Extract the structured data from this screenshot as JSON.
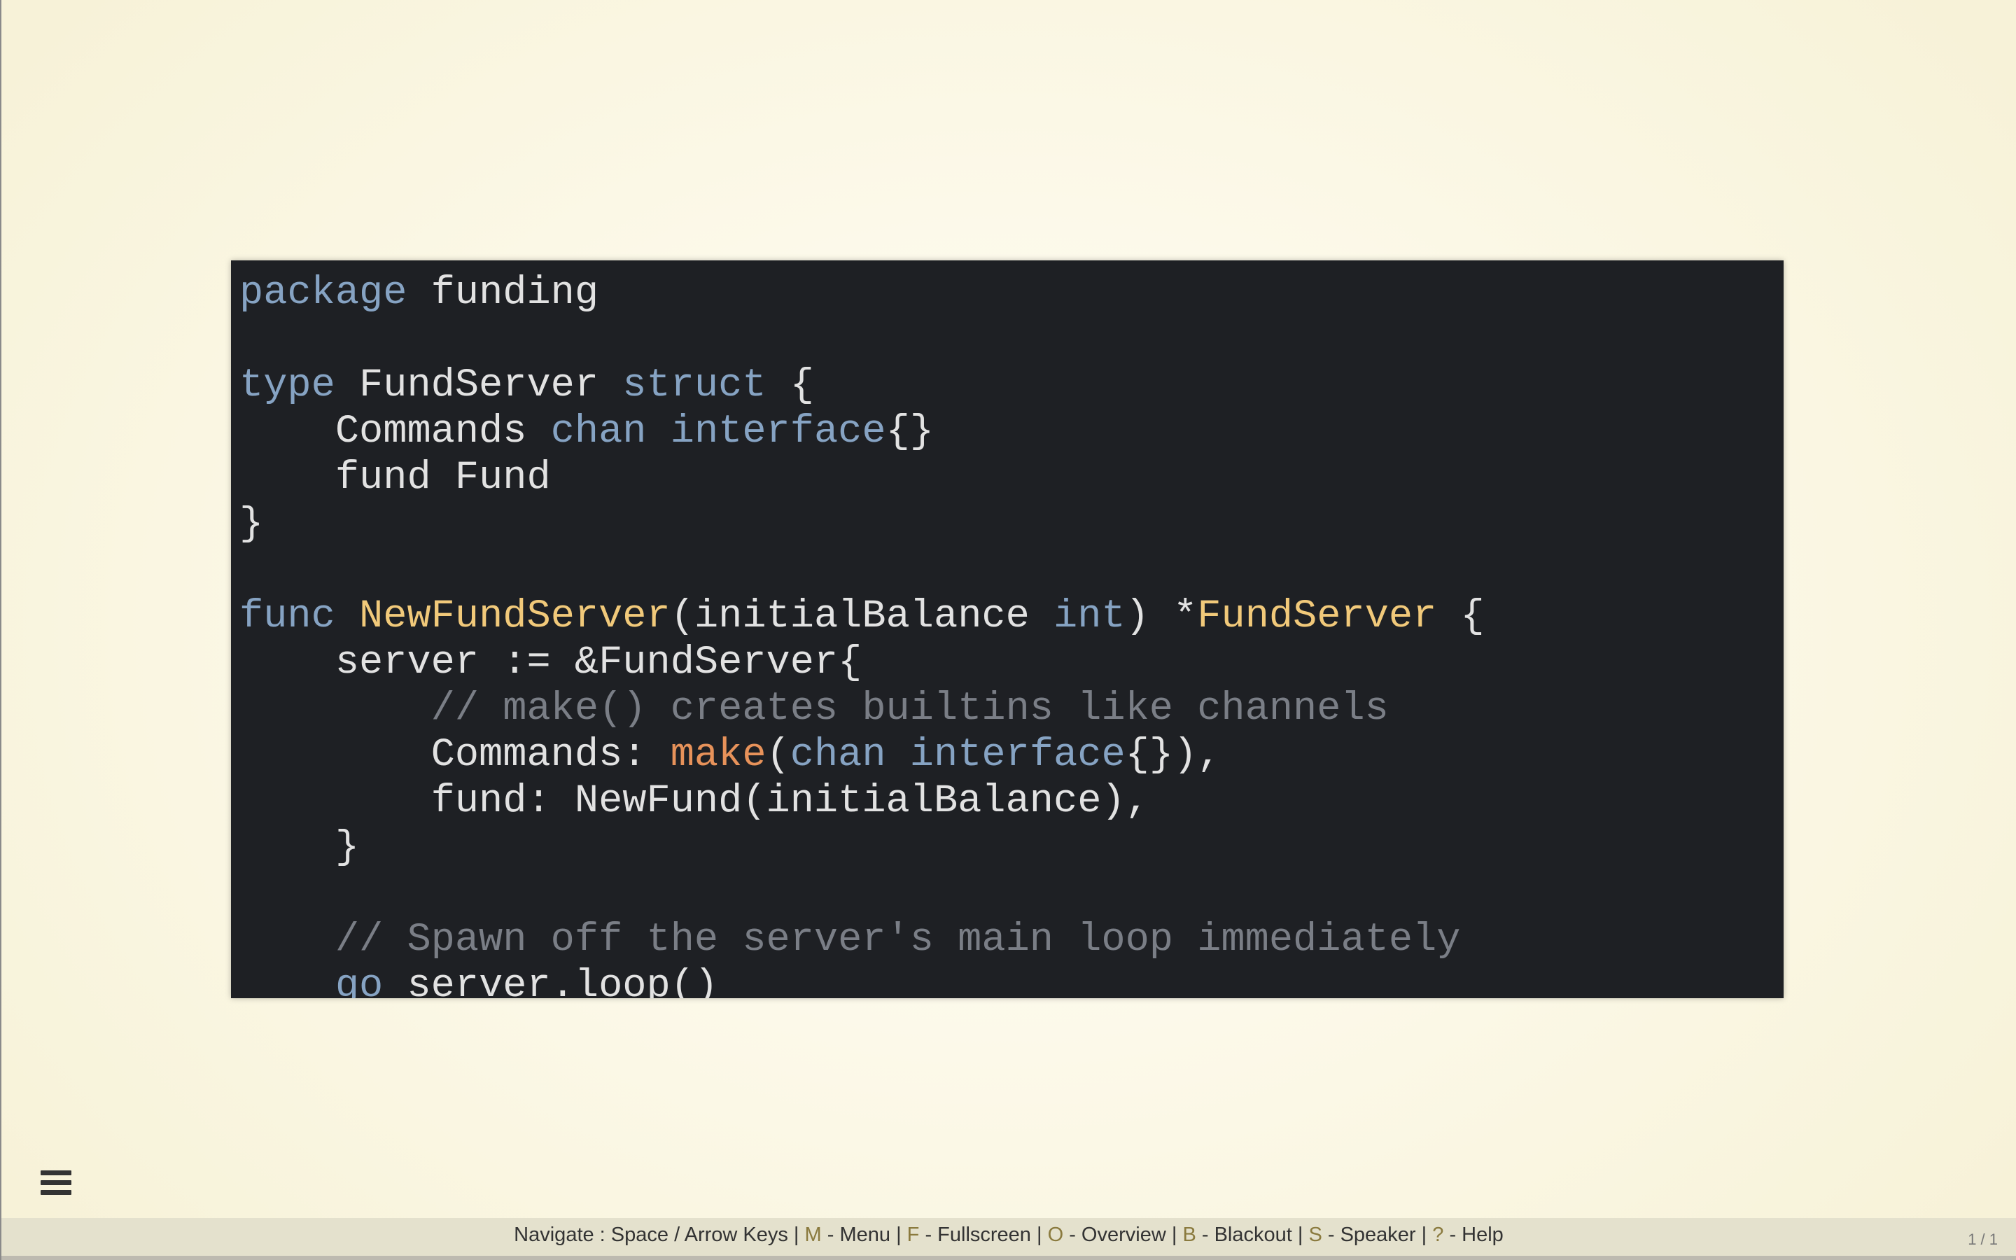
{
  "code": {
    "lines": [
      [
        {
          "t": "package",
          "c": "kw"
        },
        {
          "t": " funding",
          "c": ""
        }
      ],
      [],
      [
        {
          "t": "type",
          "c": "kw"
        },
        {
          "t": " FundServer ",
          "c": ""
        },
        {
          "t": "struct",
          "c": "kw"
        },
        {
          "t": " {",
          "c": ""
        }
      ],
      [
        {
          "t": "    Commands ",
          "c": ""
        },
        {
          "t": "chan",
          "c": "kw"
        },
        {
          "t": " ",
          "c": ""
        },
        {
          "t": "interface",
          "c": "kw"
        },
        {
          "t": "{}",
          "c": ""
        }
      ],
      [
        {
          "t": "    fund Fund",
          "c": ""
        }
      ],
      [
        {
          "t": "}",
          "c": ""
        }
      ],
      [],
      [
        {
          "t": "func",
          "c": "kw"
        },
        {
          "t": " ",
          "c": ""
        },
        {
          "t": "NewFundServer",
          "c": "fn"
        },
        {
          "t": "(initialBalance ",
          "c": ""
        },
        {
          "t": "int",
          "c": "kw"
        },
        {
          "t": ") *",
          "c": ""
        },
        {
          "t": "FundServer",
          "c": "fn"
        },
        {
          "t": " {",
          "c": ""
        }
      ],
      [
        {
          "t": "    server := &FundServer{",
          "c": ""
        }
      ],
      [
        {
          "t": "        // make() creates builtins like channels",
          "c": "cm"
        }
      ],
      [
        {
          "t": "        Commands: ",
          "c": ""
        },
        {
          "t": "make",
          "c": "bi"
        },
        {
          "t": "(",
          "c": ""
        },
        {
          "t": "chan",
          "c": "kw"
        },
        {
          "t": " ",
          "c": ""
        },
        {
          "t": "interface",
          "c": "kw"
        },
        {
          "t": "{}),",
          "c": ""
        }
      ],
      [
        {
          "t": "        fund: NewFund(initialBalance),",
          "c": ""
        }
      ],
      [
        {
          "t": "    }",
          "c": ""
        }
      ],
      [],
      [
        {
          "t": "    // Spawn off the server's main loop immediately",
          "c": "cm"
        }
      ],
      [
        {
          "t": "    ",
          "c": ""
        },
        {
          "t": "go",
          "c": "kw"
        },
        {
          "t": " server.loop()",
          "c": ""
        }
      ]
    ]
  },
  "menu": {
    "icon": "hamburger-menu-icon"
  },
  "help_bar": {
    "navigate_label": "Navigate : Space / Arrow Keys",
    "sep": " | ",
    "items": [
      {
        "key": "M",
        "label": " - Menu"
      },
      {
        "key": "F",
        "label": " - Fullscreen"
      },
      {
        "key": "O",
        "label": " - Overview"
      },
      {
        "key": "B",
        "label": " - Blackout"
      },
      {
        "key": "S",
        "label": " - Speaker"
      },
      {
        "key": "?",
        "label": " - Help"
      }
    ]
  },
  "slide_number": "1 / 1",
  "colors": {
    "keyword": "#86a3c3",
    "function": "#f1c97a",
    "builtin": "#e7925a",
    "comment": "#7a7e86",
    "code_background": "#1e2024",
    "help_key": "#8a7a3e"
  }
}
